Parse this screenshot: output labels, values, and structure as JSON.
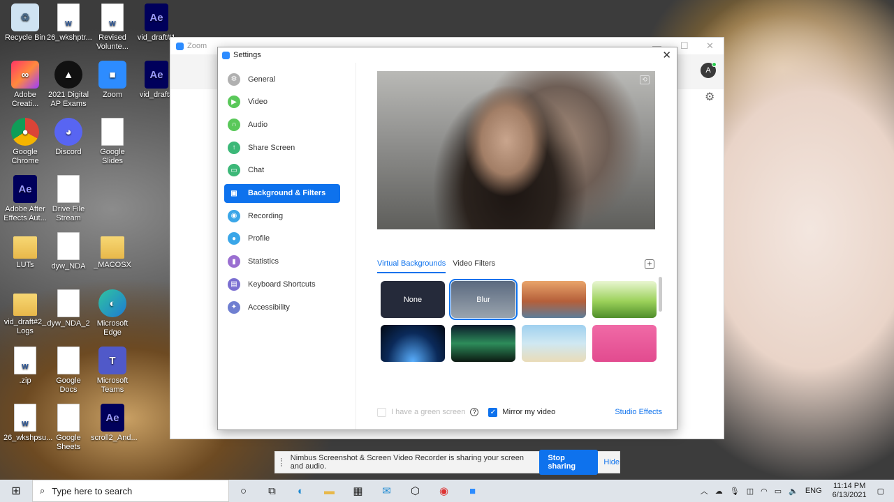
{
  "desktop": {
    "icons": [
      {
        "label": "Recycle Bin",
        "name": "recycle-bin-icon"
      },
      {
        "label": "26_wkshptr...",
        "name": "word-doc-icon"
      },
      {
        "label": "Revised Volunte...",
        "name": "word-doc-icon"
      },
      {
        "label": "vid_draft#1",
        "name": "after-effects-icon"
      },
      {
        "label": "Adobe Creati...",
        "name": "adobe-cc-icon"
      },
      {
        "label": "2021 Digital AP Exams",
        "name": "ap-exams-icon"
      },
      {
        "label": "Zoom",
        "name": "zoom-icon"
      },
      {
        "label": "vid_draft#",
        "name": "after-effects-icon"
      },
      {
        "label": "Google Chrome",
        "name": "chrome-icon"
      },
      {
        "label": "Discord",
        "name": "discord-icon"
      },
      {
        "label": "Google Slides",
        "name": "doc-icon"
      },
      {
        "label": "Adobe After Effects Aut...",
        "name": "after-effects-icon"
      },
      {
        "label": "Drive File Stream",
        "name": "doc-icon"
      },
      {
        "label": "LUTs",
        "name": "folder-icon"
      },
      {
        "label": "dyw_NDA",
        "name": "doc-icon"
      },
      {
        "label": "_MACOSX",
        "name": "folder-icon"
      },
      {
        "label": "vid_draft#2_ Logs",
        "name": "folder-icon"
      },
      {
        "label": "dyw_NDA_2",
        "name": "doc-icon"
      },
      {
        "label": "Microsoft Edge",
        "name": "edge-icon"
      },
      {
        "label": ".zip",
        "name": "word-doc-icon"
      },
      {
        "label": "Google Docs",
        "name": "doc-icon"
      },
      {
        "label": "Microsoft Teams",
        "name": "teams-icon"
      },
      {
        "label": "26_wkshpsu...",
        "name": "word-doc-icon"
      },
      {
        "label": "Google Sheets",
        "name": "doc-icon"
      },
      {
        "label": "scroll2_And...",
        "name": "after-effects-icon"
      }
    ]
  },
  "zoom_main": {
    "title": "Zoom",
    "avatar_letter": "A"
  },
  "settings": {
    "title": "Settings",
    "nav": [
      {
        "label": "General",
        "color": "#b0b0b0",
        "glyph": "⚙"
      },
      {
        "label": "Video",
        "color": "#5ac85a",
        "glyph": "▶"
      },
      {
        "label": "Audio",
        "color": "#5ac85a",
        "glyph": "∩"
      },
      {
        "label": "Share Screen",
        "color": "#3cb878",
        "glyph": "↑"
      },
      {
        "label": "Chat",
        "color": "#3cb878",
        "glyph": "▭"
      },
      {
        "label": "Background & Filters",
        "color": "#0e72ed",
        "glyph": "▣"
      },
      {
        "label": "Recording",
        "color": "#3aa6e8",
        "glyph": "◉"
      },
      {
        "label": "Profile",
        "color": "#3aa6e8",
        "glyph": "●"
      },
      {
        "label": "Statistics",
        "color": "#9a6fd1",
        "glyph": "▮"
      },
      {
        "label": "Keyboard Shortcuts",
        "color": "#7b6fd1",
        "glyph": "▤"
      },
      {
        "label": "Accessibility",
        "color": "#6f7fd1",
        "glyph": "✦"
      }
    ],
    "active_nav": "Background & Filters",
    "tabs": [
      "Virtual Backgrounds",
      "Video Filters"
    ],
    "active_tab": "Virtual Backgrounds",
    "backgrounds": [
      {
        "label": "None",
        "style": "#252a3a"
      },
      {
        "label": "Blur",
        "style": "linear-gradient(#5b6a80,#9aa4ae)"
      },
      {
        "label": "",
        "style": "linear-gradient(#e9a46a,#b55f3a 55%,#5d7d99)"
      },
      {
        "label": "",
        "style": "linear-gradient(#e9f6d2,#9bd15a 55%,#4f8e2a)"
      },
      {
        "label": "",
        "style": "radial-gradient(ellipse at 50% 100%,#5ab0ff,#0b2a5a 55%,#020812)"
      },
      {
        "label": "",
        "style": "linear-gradient(#0b1a2a,#2d8c5a 50%,#0c1a12)"
      },
      {
        "label": "",
        "style": "linear-gradient(#9fd0ef,#cfe8f2 50%,#e9dcb8)"
      },
      {
        "label": "",
        "style": "linear-gradient(#f06aa6,#e24b8f)"
      }
    ],
    "selected_background": "Blur",
    "green_screen_label": "I have a green screen",
    "mirror_label": "Mirror my video",
    "mirror_checked": true,
    "studio_effects": "Studio Effects"
  },
  "sharebar": {
    "message": "Nimbus Screenshot & Screen Video Recorder is sharing your screen and audio.",
    "stop": "Stop sharing",
    "hide": "Hide"
  },
  "taskbar": {
    "search_placeholder": "Type here to search",
    "language": "ENG",
    "time": "11:14 PM",
    "date": "6/13/2021"
  }
}
